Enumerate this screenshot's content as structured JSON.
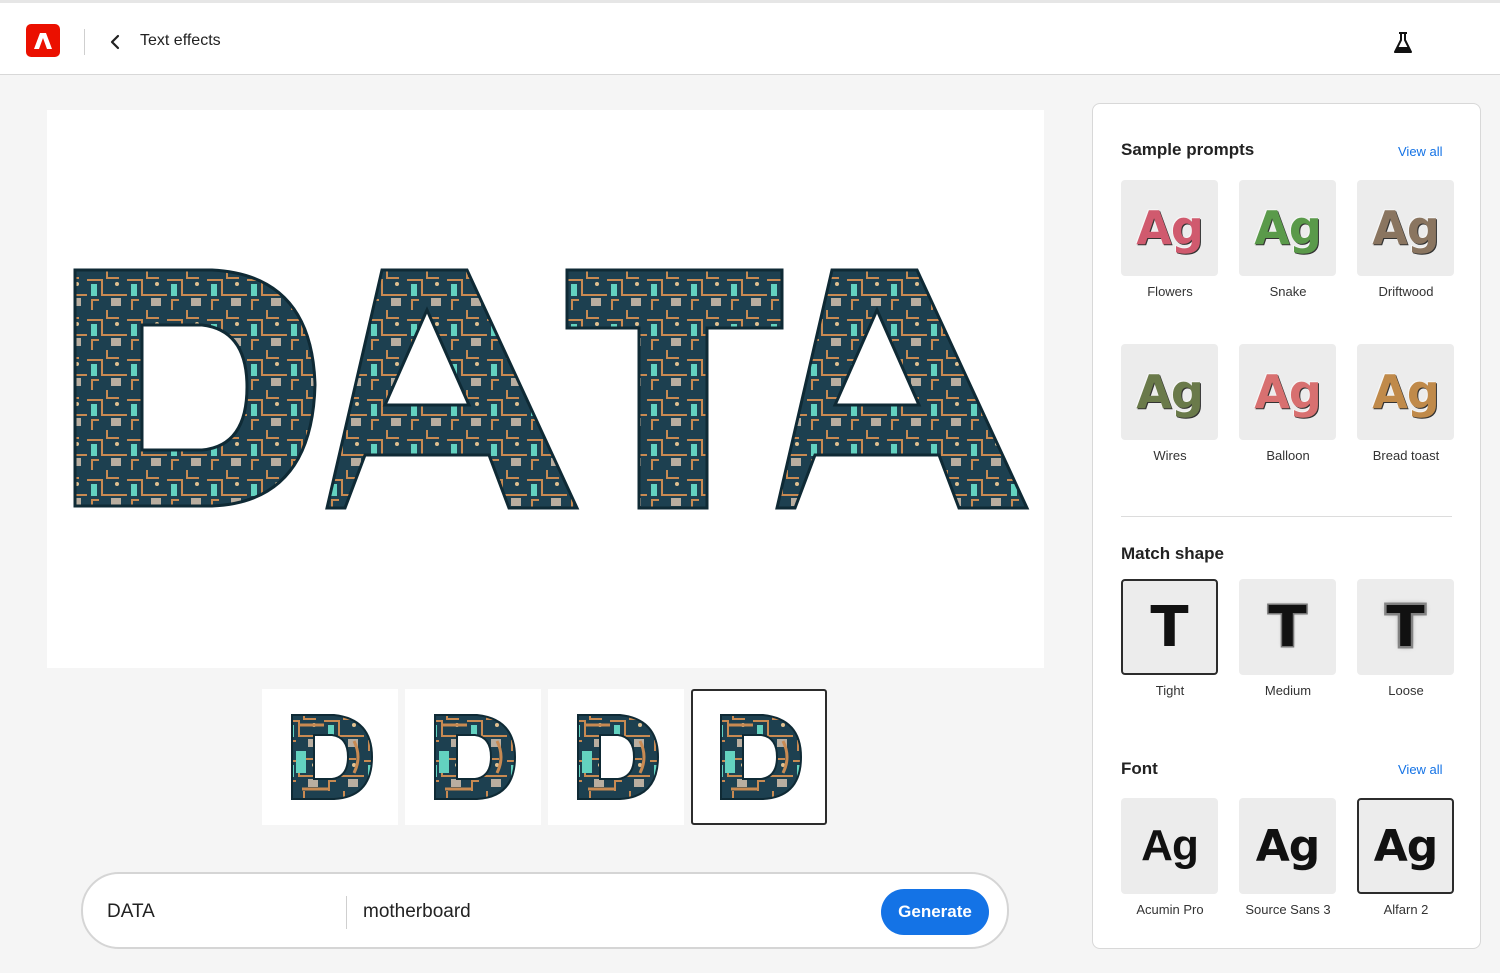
{
  "header": {
    "title": "Text effects",
    "logo_icon": "adobe-express-logo",
    "back_icon": "chevron-left-icon",
    "labs_icon": "flask-icon"
  },
  "canvas": {
    "text": "DATA",
    "effect": "motherboard",
    "colors": {
      "board": "#1d4050",
      "teal": "#63d2c0",
      "copper": "#c88a52",
      "chip": "#b9aea0"
    }
  },
  "variations": [
    {
      "letter": "D",
      "selected": false
    },
    {
      "letter": "D",
      "selected": false
    },
    {
      "letter": "D",
      "selected": false
    },
    {
      "letter": "D",
      "selected": true
    }
  ],
  "prompt_bar": {
    "text_value": "DATA",
    "prompt_value": "motherboard",
    "generate_label": "Generate"
  },
  "panel": {
    "sample_prompts": {
      "title": "Sample prompts",
      "view_all": "View all",
      "items": [
        {
          "label": "Flowers",
          "sample": "Ag",
          "color": "#d05a6e"
        },
        {
          "label": "Snake",
          "sample": "Ag",
          "color": "#5a9a4a"
        },
        {
          "label": "Driftwood",
          "sample": "Ag",
          "color": "#8a7560"
        },
        {
          "label": "Wires",
          "sample": "Ag",
          "color": "#6a7a4a"
        },
        {
          "label": "Balloon",
          "sample": "Ag",
          "color": "#d87070"
        },
        {
          "label": "Bread toast",
          "sample": "Ag",
          "color": "#c08a4a"
        }
      ]
    },
    "match_shape": {
      "title": "Match shape",
      "items": [
        {
          "label": "Tight",
          "sample": "T",
          "selected": true
        },
        {
          "label": "Medium",
          "sample": "T",
          "selected": false
        },
        {
          "label": "Loose",
          "sample": "T",
          "selected": false
        }
      ]
    },
    "font": {
      "title": "Font",
      "view_all": "View all",
      "items": [
        {
          "label": "Acumin Pro",
          "sample": "Ag",
          "selected": false
        },
        {
          "label": "Source Sans 3",
          "sample": "Ag",
          "selected": false
        },
        {
          "label": "Alfarn 2",
          "sample": "Ag",
          "selected": true
        }
      ]
    }
  }
}
